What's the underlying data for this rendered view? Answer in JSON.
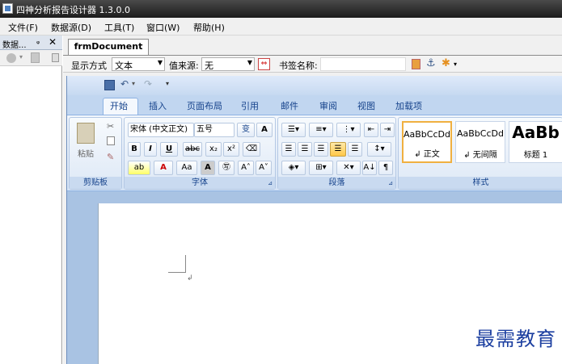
{
  "title": "四神分析报告设计器 1.3.0.0",
  "menu": [
    "文件(F)",
    "数据源(D)",
    "工具(T)",
    "窗口(W)",
    "帮助(H)"
  ],
  "left_panel": {
    "title": "数据...",
    "pin": "ᵩ",
    "close": "✕"
  },
  "doc_tab": "frmDocument",
  "toolbar": {
    "display_label": "显示方式",
    "display_value": "文本",
    "source_label": "值来源:",
    "source_value": "无",
    "bookmark_label": "书签名称:"
  },
  "ribbon_tabs": [
    "开始",
    "插入",
    "页面布局",
    "引用",
    "邮件",
    "审阅",
    "视图",
    "加载项"
  ],
  "groups": {
    "clipboard": "剪贴板",
    "font": "字体",
    "paragraph": "段落",
    "styles": "样式"
  },
  "clipboard": {
    "paste": "粘贴"
  },
  "font": {
    "name": "宋体 (中文正文)",
    "size": "五号"
  },
  "styles": [
    {
      "sample": "AaBbCcDd",
      "name": "↲ 正文"
    },
    {
      "sample": "AaBbCcDd",
      "name": "↲ 无间隔"
    },
    {
      "sample": "AaBb",
      "name": "标题 1"
    }
  ],
  "watermark": "最需教育"
}
